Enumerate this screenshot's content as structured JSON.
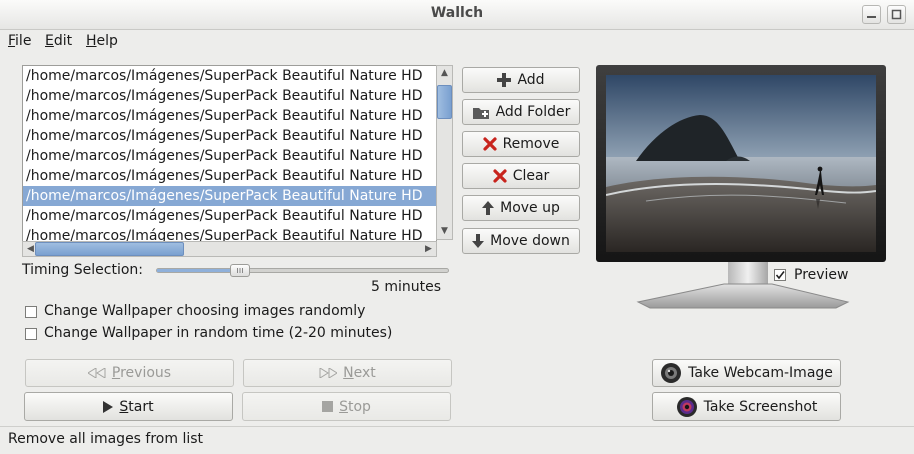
{
  "window": {
    "title": "Wallch"
  },
  "menu": [
    {
      "label": "File"
    },
    {
      "label": "Edit"
    },
    {
      "label": "Help"
    }
  ],
  "images": [
    "/home/marcos/Imágenes/SuperPack Beautiful Nature HD",
    "/home/marcos/Imágenes/SuperPack Beautiful Nature HD",
    "/home/marcos/Imágenes/SuperPack Beautiful Nature HD",
    "/home/marcos/Imágenes/SuperPack Beautiful Nature HD",
    "/home/marcos/Imágenes/SuperPack Beautiful Nature HD",
    "/home/marcos/Imágenes/SuperPack Beautiful Nature HD",
    "/home/marcos/Imágenes/SuperPack Beautiful Nature HD",
    "/home/marcos/Imágenes/SuperPack Beautiful Nature HD",
    "/home/marcos/Imágenes/SuperPack Beautiful Nature HD"
  ],
  "selected_index": 6,
  "buttons": {
    "add": "Add",
    "add_folder": "Add Folder",
    "remove": "Remove",
    "clear": "Clear",
    "move_up": "Move up",
    "move_down": "Move down"
  },
  "timing": {
    "label": "Timing Selection:",
    "value_text": "5 minutes",
    "slider_fraction": 0.27
  },
  "options": {
    "random_images": "Change Wallpaper choosing images randomly",
    "random_time": "Change Wallpaper in random time (2-20 minutes)",
    "random_images_checked": false,
    "random_time_checked": false
  },
  "controls": {
    "previous": "Previous",
    "next": "Next",
    "start": "Start",
    "stop": "Stop"
  },
  "preview": {
    "label": "Preview",
    "checked": true
  },
  "actions": {
    "webcam": "Take Webcam-Image",
    "screenshot": "Take Screenshot"
  },
  "status": "Remove all images from list"
}
